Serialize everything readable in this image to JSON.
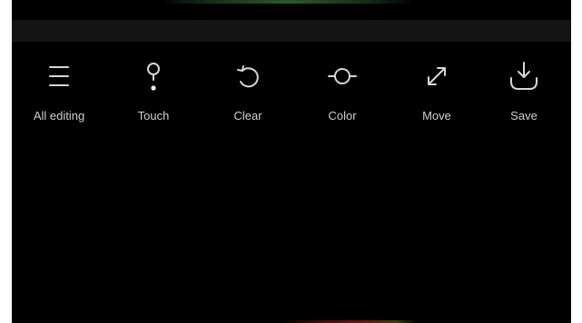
{
  "toolbar": {
    "items": [
      {
        "label": "All editing",
        "icon": "menu-icon"
      },
      {
        "label": "Touch",
        "icon": "touch-icon"
      },
      {
        "label": "Clear",
        "icon": "rotate-ccw-icon"
      },
      {
        "label": "Color",
        "icon": "color-icon"
      },
      {
        "label": "Move",
        "icon": "move-arrows-icon"
      },
      {
        "label": "Save",
        "icon": "download-icon"
      }
    ]
  },
  "colors": {
    "screen_background": "#000000",
    "topbar_background": "#141414",
    "icon_color": "#d6d6d6",
    "label_color": "#cfcfcf"
  }
}
